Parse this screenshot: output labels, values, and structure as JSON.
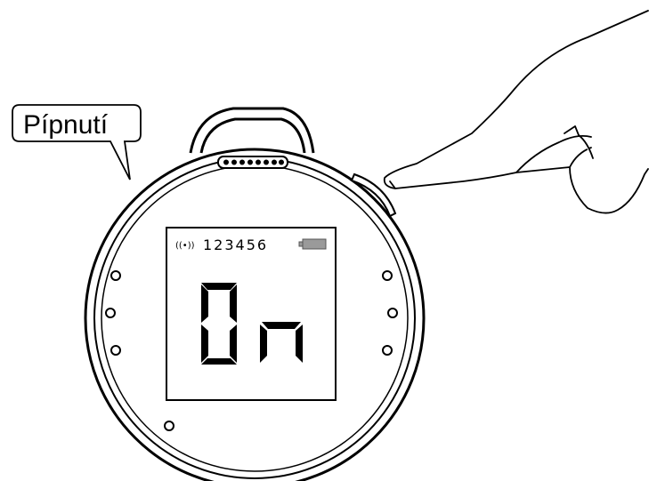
{
  "callout": {
    "label": "Pípnutí"
  },
  "display": {
    "signal_symbol": "((•))",
    "device_id": "123456",
    "main_text": "On",
    "battery_icon": "battery-icon"
  },
  "icons": {
    "finger": "pointing-finger-icon",
    "device_button": "side-button-icon"
  },
  "colors": {
    "line": "#000000",
    "battery_fill": "#9a9a9a",
    "background": "#ffffff"
  }
}
